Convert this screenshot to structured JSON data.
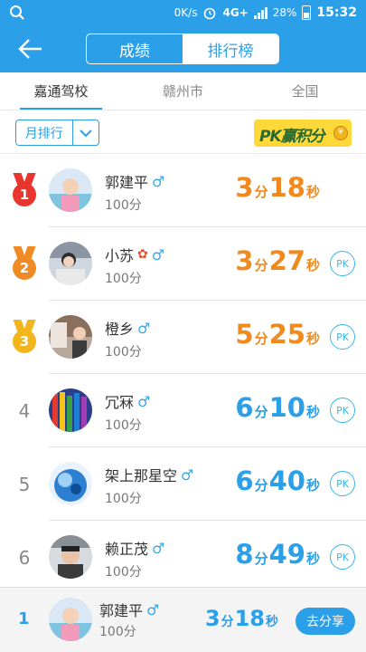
{
  "status_bar": {
    "network_speed": "0K/s",
    "network_type": "4G+",
    "battery": "28%",
    "time": "15:32"
  },
  "header": {
    "tabs": [
      "成绩",
      "排行榜"
    ],
    "active_tab": "排行榜"
  },
  "scope_tabs": [
    {
      "label": "嘉通驾校",
      "active": true
    },
    {
      "label": "赣州市",
      "active": false
    },
    {
      "label": "全国",
      "active": false
    }
  ],
  "filter": {
    "period_label": "月排行",
    "pk_badge_text": "PK赢积分",
    "coin_symbol": "¥"
  },
  "rankings": [
    {
      "rank": "1",
      "name": "郭建平",
      "gender": "♂",
      "score": "100分",
      "minutes": "3",
      "seconds": "18",
      "color": "orange",
      "pk": false,
      "flower": false
    },
    {
      "rank": "2",
      "name": "小苏",
      "gender": "♂",
      "score": "100分",
      "minutes": "3",
      "seconds": "27",
      "color": "orange",
      "pk": true,
      "flower": true
    },
    {
      "rank": "3",
      "name": "橙乡",
      "gender": "♂",
      "score": "100分",
      "minutes": "5",
      "seconds": "25",
      "color": "orange",
      "pk": true,
      "flower": false
    },
    {
      "rank": "4",
      "name": "冗冧",
      "gender": "♂",
      "score": "100分",
      "minutes": "6",
      "seconds": "10",
      "color": "blue",
      "pk": true,
      "flower": false
    },
    {
      "rank": "5",
      "name": "架上那星空",
      "gender": "♂",
      "score": "100分",
      "minutes": "6",
      "seconds": "40",
      "color": "blue",
      "pk": true,
      "flower": false
    },
    {
      "rank": "6",
      "name": "赖正茂",
      "gender": "♂",
      "score": "100分",
      "minutes": "8",
      "seconds": "49",
      "color": "blue",
      "pk": true,
      "flower": false
    }
  ],
  "units": {
    "minute": "分",
    "second": "秒"
  },
  "pk_label": "PK",
  "my_rank": {
    "rank": "1",
    "name": "郭建平",
    "gender": "♂",
    "score": "100分",
    "minutes": "3",
    "seconds": "18",
    "share_label": "去分享"
  },
  "colors": {
    "primary": "#2b9fe8",
    "orange": "#f08a1f",
    "medal_gold": "#f2b51b",
    "medal_silver": "#ef8a25",
    "medal_red": "#e8352e"
  }
}
